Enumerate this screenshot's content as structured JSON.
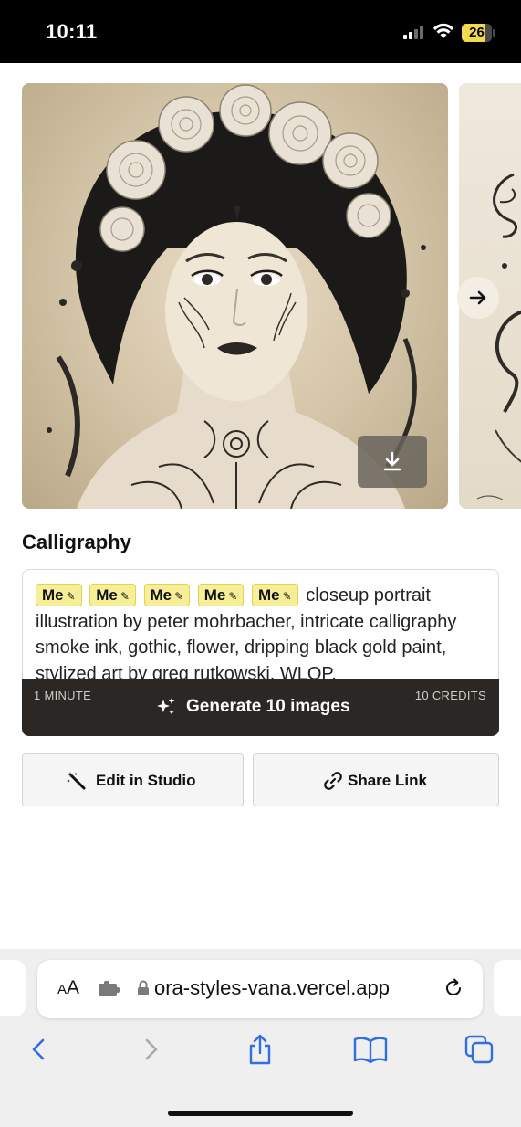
{
  "status": {
    "time": "10:11",
    "battery": "26"
  },
  "carousel": {
    "download_icon": "download-icon",
    "next_icon": "arrow-right-icon"
  },
  "style": {
    "title": "Calligraphy"
  },
  "prompt": {
    "chips": [
      "Me",
      "Me",
      "Me",
      "Me",
      "Me"
    ],
    "text": "closeup portrait illustration by peter mohrbacher, intricate calligraphy smoke ink, gothic, flower, dripping black gold paint, stylized art by greg rutkowski, WLOP,"
  },
  "generate": {
    "time": "1 MINUTE",
    "label": "Generate 10 images",
    "credits": "10 CREDITS"
  },
  "actions": {
    "edit_label": "Edit in Studio",
    "share_label": "Share Link"
  },
  "browser": {
    "aa_label": "AA",
    "url": "ora-styles-vana.vercel.app"
  },
  "colors": {
    "accent_chip": "#f7ef97",
    "generate_bar": "#2a2725",
    "safari_blue": "#2f6fe0"
  }
}
